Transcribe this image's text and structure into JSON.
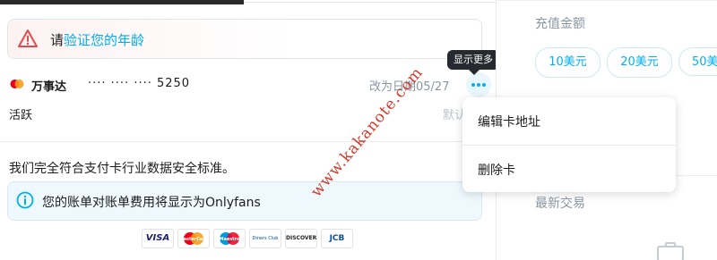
{
  "age_banner": {
    "prefix": "请",
    "link": "验证您的年龄"
  },
  "card": {
    "brand": "万事达",
    "masked_number": "···· ···· ···· 5250",
    "changed_date": "改为日期05/27",
    "status": "活跃",
    "default_label": "默认"
  },
  "tooltip": {
    "label": "显示更多"
  },
  "menu": {
    "edit_address": "编辑卡地址",
    "delete_card": "删除卡"
  },
  "security_statement": "我们完全符合支付卡行业数据安全标准。",
  "billing_notice": "您的账单对账单费用将显示为Onlyfans",
  "payment_logos": [
    {
      "name": "VISA",
      "color": "#1a1f71"
    },
    {
      "name": "MasterCard",
      "color": "#eb001b"
    },
    {
      "name": "Maestro",
      "color": "#0099df"
    },
    {
      "name": "Diners Club",
      "color": "#004a97"
    },
    {
      "name": "DISCOVER",
      "color": "#222222"
    },
    {
      "name": "JCB",
      "color": "#0e4c96"
    }
  ],
  "sidebar": {
    "topup_title": "充值金额",
    "amounts": [
      "10美元",
      "20美元",
      "50美"
    ],
    "recent_title": "最新交易"
  },
  "watermark": "www.kakanote.com",
  "colors": {
    "accent": "#00aff0",
    "warning": "#e5484d",
    "muted": "#8a96a3"
  }
}
